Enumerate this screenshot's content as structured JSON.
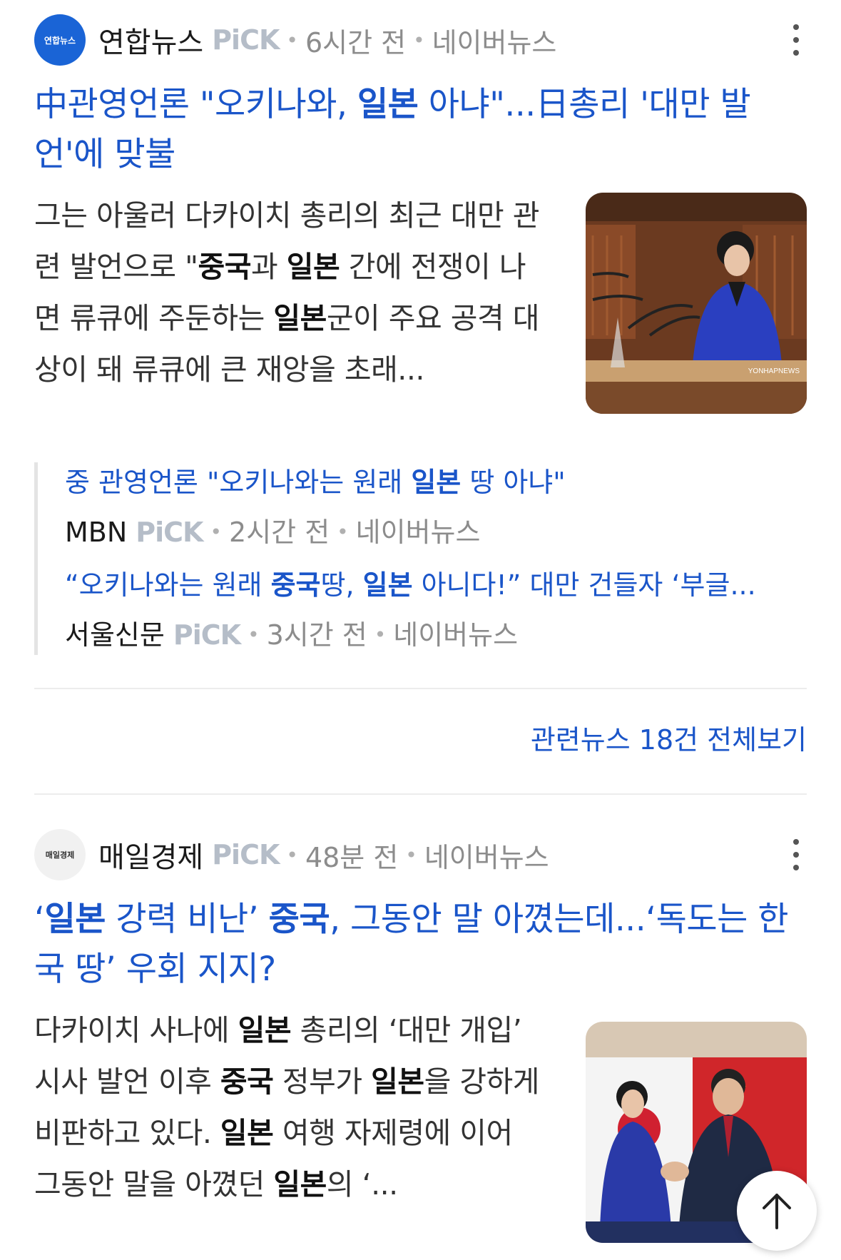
{
  "article1": {
    "source": "연합뉴스",
    "logo_text": "연합뉴스",
    "pick": "PiCK",
    "time": "6시간 전",
    "platform": "네이버뉴스",
    "title_parts": [
      "中관영언론 \"오키나와, ",
      "일본",
      " 아냐\"...日총리 '대만 발언'에 맞불"
    ],
    "body_parts": [
      "그는 아울러 다카이치 총리의 최근 대만 관련 발언으로 \"",
      "중국",
      "과 ",
      "일본",
      " 간에 전쟁이 나면 류큐에 주둔하는 ",
      "일본",
      "군이 주요 공격 대상이 돼 류큐에 큰 재앙을 초래..."
    ],
    "thumb_watermark": "YONHAPNEWS"
  },
  "related": [
    {
      "title_parts": [
        "중 관영언론 \"오키나와는 원래 ",
        "일본",
        " 땅 아냐\""
      ],
      "source": "MBN",
      "pick": "PiCK",
      "time": "2시간 전",
      "platform": "네이버뉴스"
    },
    {
      "title_parts": [
        "“오키나와는 원래 ",
        "중국",
        "땅, ",
        "일본",
        " 아니다!” 대만 건들자 ‘부글..."
      ],
      "source": "서울신문",
      "pick": "PiCK",
      "time": "3시간 전",
      "platform": "네이버뉴스"
    }
  ],
  "more_link": "관련뉴스 18건 전체보기",
  "article2": {
    "source": "매일경제",
    "logo_text": "매일경제",
    "pick": "PiCK",
    "time": "48분 전",
    "platform": "네이버뉴스",
    "title_parts": [
      "‘",
      "일본",
      " 강력 비난’ ",
      "중국",
      ", 그동안 말 아꼈는데...‘독도는 한국 땅’ 우회 지지?"
    ],
    "body_parts": [
      "다카이치 사나에 ",
      "일본",
      " 총리의 ‘대만 개입’ 시사 발언 이후 ",
      "중국",
      " 정부가 ",
      "일본",
      "을 강하게 비판하고 있다. ",
      "일본",
      " 여행 자제령에 이어 그동안 말을 아꼈던 ",
      "일본",
      "의 ‘..."
    ]
  },
  "icons": {
    "kebab": "more-vertical-icon",
    "scroll_top": "arrow-up-icon"
  },
  "colors": {
    "link": "#1a55c9",
    "pick": "#b5bdc8",
    "yonhap_logo": "#1a64d6"
  }
}
